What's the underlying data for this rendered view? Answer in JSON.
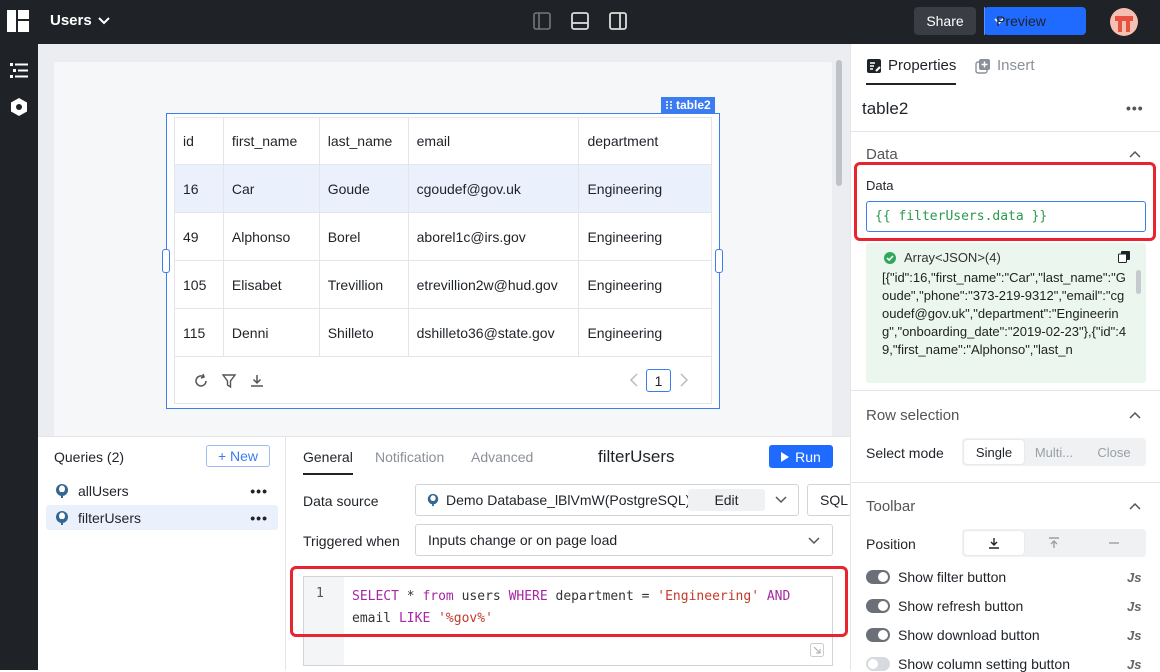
{
  "header": {
    "app_title": "Users",
    "share_label": "Share",
    "preview_label": "Preview"
  },
  "table_widget": {
    "tag": "table2",
    "columns": [
      "id",
      "first_name",
      "last_name",
      "email",
      "department"
    ],
    "rows": [
      [
        "16",
        "Car",
        "Goude",
        "cgoudef@gov.uk",
        "Engineering"
      ],
      [
        "49",
        "Alphonso",
        "Borel",
        "aborel1c@irs.gov",
        "Engineering"
      ],
      [
        "105",
        "Elisabet",
        "Trevillion",
        "etrevillion2w@hud.gov",
        "Engineering"
      ],
      [
        "115",
        "Denni",
        "Shilleto",
        "dshilleto36@state.gov",
        "Engineering"
      ]
    ],
    "page": "1"
  },
  "queries": {
    "title": "Queries (2)",
    "new_label": "+ New",
    "items": [
      {
        "name": "allUsers"
      },
      {
        "name": "filterUsers"
      }
    ],
    "tabs": [
      "General",
      "Notification",
      "Advanced"
    ],
    "active_query": "filterUsers",
    "run_label": "Run",
    "data_source_label": "Data source",
    "data_source_value": "Demo Database_lBlVmW(PostgreSQL)",
    "edit_label": "Edit",
    "sql_label": "SQL",
    "triggered_label": "Triggered when",
    "triggered_value": "Inputs change or on page load",
    "line_number": "1"
  },
  "properties": {
    "tabs": {
      "properties": "Properties",
      "insert": "Insert"
    },
    "component_name": "table2",
    "data_section": "Data",
    "data_field_label": "Data",
    "data_field_value": "{{ filterUsers.data }}",
    "preview_type": "Array<JSON>(4)",
    "preview_json": "[{\"id\":16,\"first_name\":\"Car\",\"last_name\":\"Goude\",\"phone\":\"373-219-9312\",\"email\":\"cgoudef@gov.uk\",\"department\":\"Engineering\",\"onboarding_date\":\"2019-02-23\"},{\"id\":49,\"first_name\":\"Alphonso\",\"last_n",
    "row_selection_section": "Row selection",
    "select_mode_label": "Select mode",
    "select_modes": [
      "Single",
      "Multi...",
      "Close"
    ],
    "toolbar_section": "Toolbar",
    "position_label": "Position",
    "toggles": [
      {
        "label": "Show filter button",
        "on": true
      },
      {
        "label": "Show refresh button",
        "on": true
      },
      {
        "label": "Show download button",
        "on": true
      },
      {
        "label": "Show column setting button",
        "on": false
      }
    ],
    "js_label": "Js"
  },
  "colors": {
    "accent": "#1f6bff",
    "selection": "#3b7cf0",
    "highlight": "#e8242f"
  }
}
